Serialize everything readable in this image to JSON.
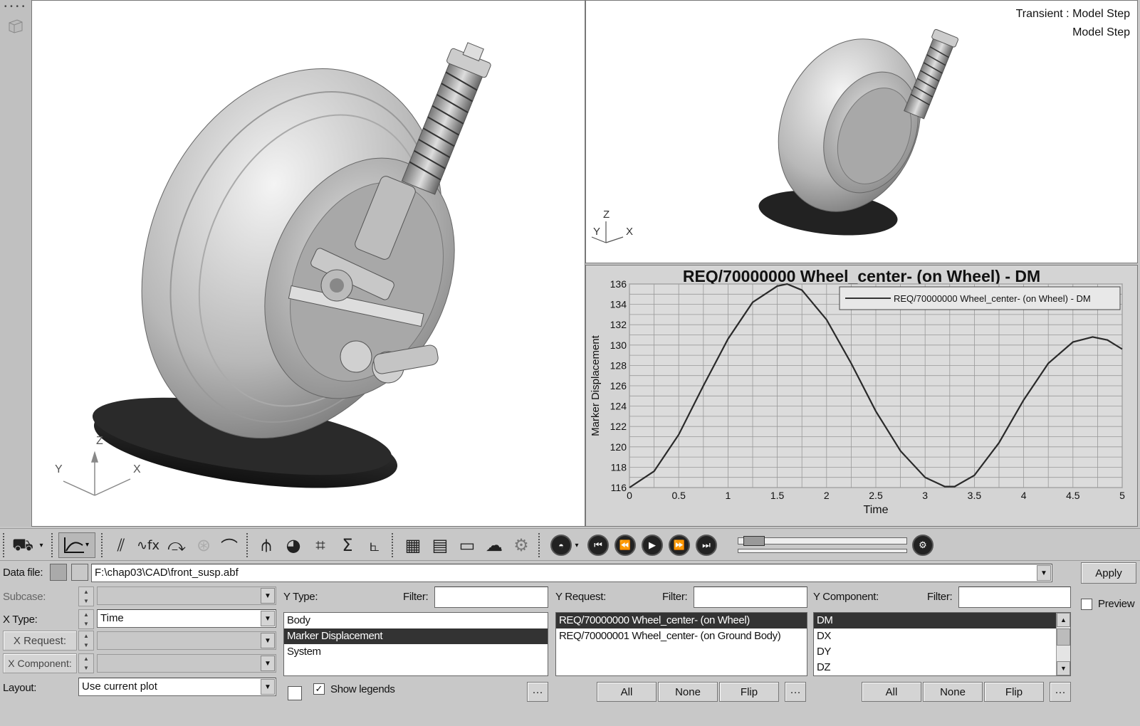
{
  "viewports": {
    "main": {
      "axis_x": "X",
      "axis_y": "Y",
      "axis_z": "Z"
    },
    "small": {
      "label_line1": "Transient : Model Step",
      "label_line2": "Model Step",
      "axis_x": "X",
      "axis_y": "Y",
      "axis_z": "Z"
    }
  },
  "chart_data": {
    "type": "line",
    "title": "REQ/70000000 Wheel_center- (on Wheel) - DM",
    "xlabel": "Time",
    "ylabel": "Marker Displacement",
    "xlim": [
      0,
      5
    ],
    "ylim": [
      116,
      136
    ],
    "x_ticks": [
      "0",
      "0.5",
      "1",
      "1.5",
      "2",
      "2.5",
      "3",
      "3.5",
      "4",
      "4.5",
      "5"
    ],
    "y_ticks": [
      "116",
      "118",
      "120",
      "122",
      "124",
      "126",
      "128",
      "130",
      "132",
      "134",
      "136"
    ],
    "grid": true,
    "legend_position": "top-right",
    "series": [
      {
        "name": "REQ/70000000 Wheel_center- (on Wheel) - DM",
        "x": [
          0,
          0.25,
          0.5,
          0.75,
          1.0,
          1.25,
          1.5,
          1.6,
          1.75,
          2.0,
          2.25,
          2.5,
          2.75,
          3.0,
          3.2,
          3.3,
          3.5,
          3.75,
          4.0,
          4.25,
          4.5,
          4.7,
          4.85,
          5.0
        ],
        "y": [
          116.0,
          117.6,
          121.2,
          126.0,
          130.6,
          134.2,
          135.8,
          136.0,
          135.4,
          132.5,
          128.2,
          123.5,
          119.6,
          117.0,
          116.1,
          116.1,
          117.2,
          120.4,
          124.6,
          128.2,
          130.3,
          130.8,
          130.5,
          129.6
        ]
      }
    ]
  },
  "toolbar": {
    "sigma": "Σ"
  },
  "panel": {
    "data_file_label": "Data file:",
    "data_file_value": "F:\\chap03\\CAD\\front_susp.abf",
    "apply_label": "Apply",
    "preview_label": "Preview",
    "subcase_label": "Subcase:",
    "subcase_value": "",
    "x_type_label": "X Type:",
    "x_type_value": "Time",
    "x_request_label": "X Request:",
    "x_request_value": "",
    "x_component_label": "X Component:",
    "x_component_value": "",
    "layout_label": "Layout:",
    "layout_value": "Use current plot",
    "y_type_label": "Y Type:",
    "y_type_filter_label": "Filter:",
    "y_type_filter_value": "",
    "y_type_items": [
      "Body",
      "Marker Displacement",
      "System"
    ],
    "y_type_selected": 1,
    "y_request_label": "Y Request:",
    "y_request_filter_label": "Filter:",
    "y_request_filter_value": "",
    "y_request_items": [
      "REQ/70000000 Wheel_center- (on Wheel)",
      "REQ/70000001 Wheel_center- (on Ground Body)"
    ],
    "y_request_selected": 0,
    "y_component_label": "Y Component:",
    "y_component_filter_label": "Filter:",
    "y_component_filter_value": "",
    "y_component_items": [
      "DM",
      "DX",
      "DY",
      "DZ"
    ],
    "y_component_selected": 0,
    "show_legends_label": "Show legends",
    "show_legends_checked": "✓",
    "more_label": "···",
    "all_label": "All",
    "none_label": "None",
    "flip_label": "Flip"
  }
}
